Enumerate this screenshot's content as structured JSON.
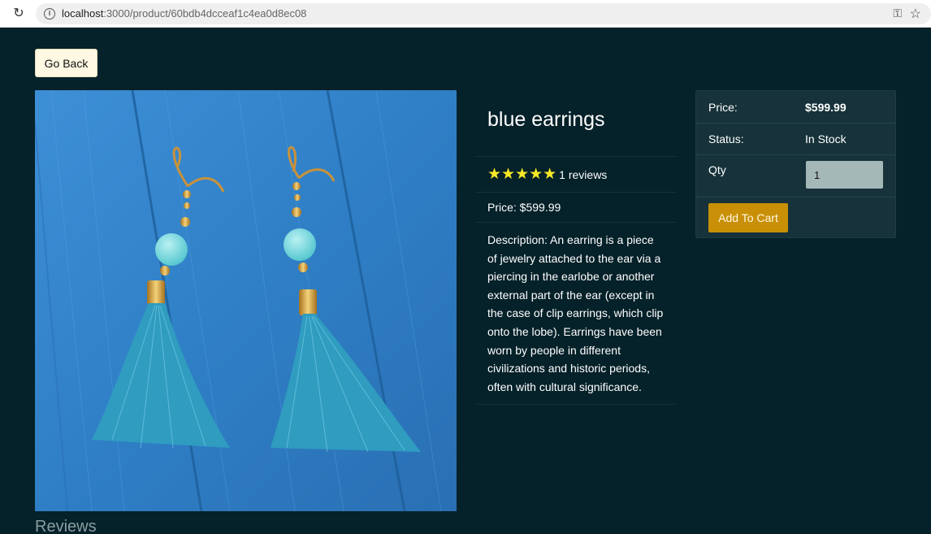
{
  "browser": {
    "url_host": "localhost",
    "url_path": ":3000/product/60bdb4dcceaf1c4ea0d8ec08"
  },
  "page": {
    "go_back_label": "Go Back",
    "reviews_heading": "Reviews"
  },
  "product": {
    "name": "blue earrings",
    "rating_stars": 5,
    "reviews_text": "1 reviews",
    "price_text": "Price: $599.99",
    "description": "Description: An earring is a piece of jewelry attached to the ear via a piercing in the earlobe or another external part of the ear (except in the case of clip earrings, which clip onto the lobe). Earrings have been worn by people in different civilizations and historic periods, often with cultural significance.",
    "image_alt": "blue earrings"
  },
  "cart_card": {
    "price_label": "Price:",
    "price_value": "$599.99",
    "status_label": "Status:",
    "status_value": "In Stock",
    "qty_label": "Qty",
    "qty_selected": "1",
    "add_to_cart_label": "Add To Cart"
  },
  "colors": {
    "page_bg": "#052129",
    "card_bg": "#17323a",
    "star": "#f8e825",
    "add_to_cart_bg": "#c99007",
    "go_back_bg": "#fff8e3"
  }
}
